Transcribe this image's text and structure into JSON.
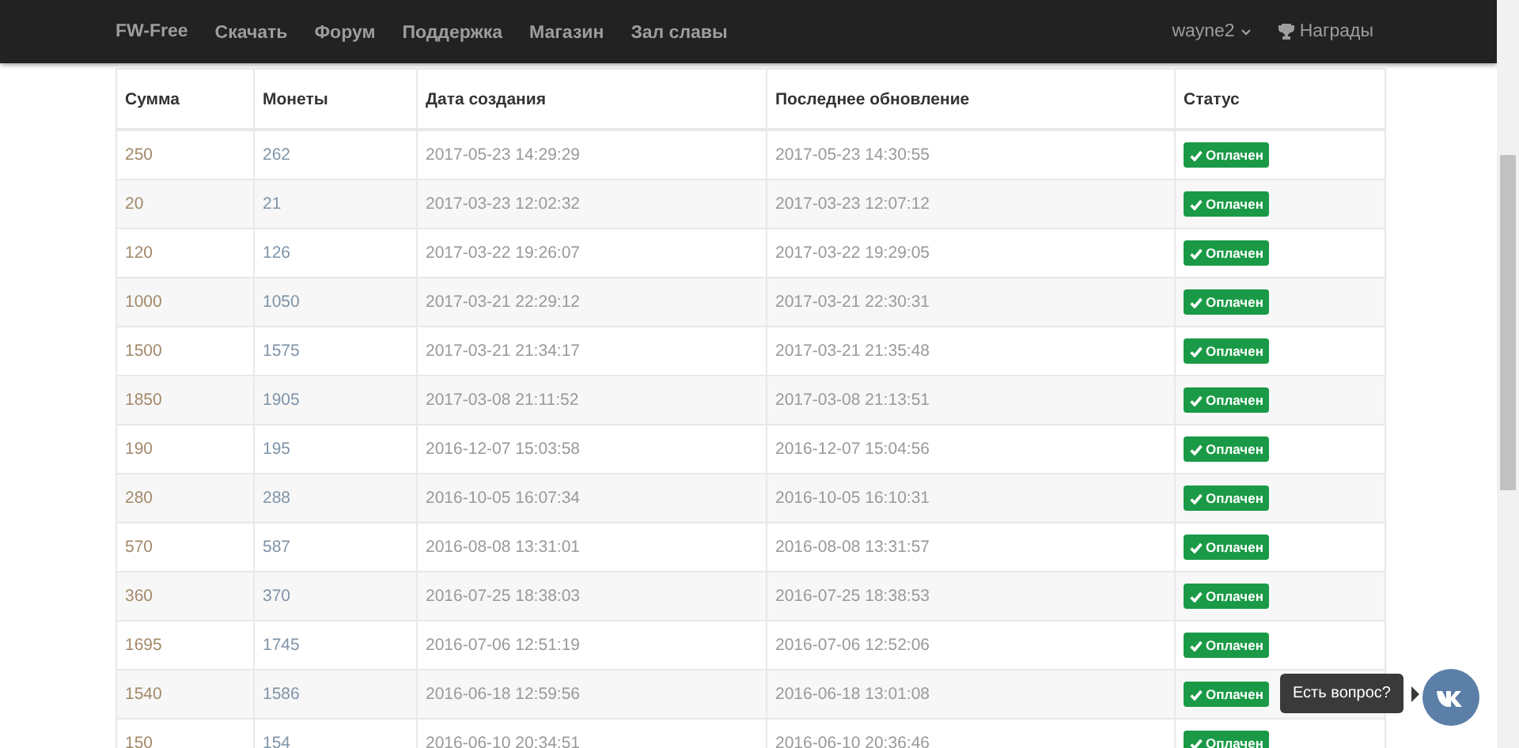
{
  "navbar": {
    "brand": "FW-Free",
    "links": [
      "Скачать",
      "Форум",
      "Поддержка",
      "Магазин",
      "Зал славы"
    ],
    "user": "wayne2",
    "awards": "Награды"
  },
  "table": {
    "columns": [
      "Сумма",
      "Монеты",
      "Дата создания",
      "Последнее обновление",
      "Статус"
    ],
    "rows": [
      {
        "sum": "250",
        "coins": "262",
        "created": "2017-05-23 14:29:29",
        "updated": "2017-05-23 14:30:55",
        "status": "Оплачен"
      },
      {
        "sum": "20",
        "coins": "21",
        "created": "2017-03-23 12:02:32",
        "updated": "2017-03-23 12:07:12",
        "status": "Оплачен"
      },
      {
        "sum": "120",
        "coins": "126",
        "created": "2017-03-22 19:26:07",
        "updated": "2017-03-22 19:29:05",
        "status": "Оплачен"
      },
      {
        "sum": "1000",
        "coins": "1050",
        "created": "2017-03-21 22:29:12",
        "updated": "2017-03-21 22:30:31",
        "status": "Оплачен"
      },
      {
        "sum": "1500",
        "coins": "1575",
        "created": "2017-03-21 21:34:17",
        "updated": "2017-03-21 21:35:48",
        "status": "Оплачен"
      },
      {
        "sum": "1850",
        "coins": "1905",
        "created": "2017-03-08 21:11:52",
        "updated": "2017-03-08 21:13:51",
        "status": "Оплачен"
      },
      {
        "sum": "190",
        "coins": "195",
        "created": "2016-12-07 15:03:58",
        "updated": "2016-12-07 15:04:56",
        "status": "Оплачен"
      },
      {
        "sum": "280",
        "coins": "288",
        "created": "2016-10-05 16:07:34",
        "updated": "2016-10-05 16:10:31",
        "status": "Оплачен"
      },
      {
        "sum": "570",
        "coins": "587",
        "created": "2016-08-08 13:31:01",
        "updated": "2016-08-08 13:31:57",
        "status": "Оплачен"
      },
      {
        "sum": "360",
        "coins": "370",
        "created": "2016-07-25 18:38:03",
        "updated": "2016-07-25 18:38:53",
        "status": "Оплачен"
      },
      {
        "sum": "1695",
        "coins": "1745",
        "created": "2016-07-06 12:51:19",
        "updated": "2016-07-06 12:52:06",
        "status": "Оплачен"
      },
      {
        "sum": "1540",
        "coins": "1586",
        "created": "2016-06-18 12:59:56",
        "updated": "2016-06-18 13:01:08",
        "status": "Оплачен"
      },
      {
        "sum": "150",
        "coins": "154",
        "created": "2016-06-10 20:34:51",
        "updated": "2016-06-10 20:36:46",
        "status": "Оплачен"
      }
    ]
  },
  "chat_widget": {
    "tooltip": "Есть вопрос?"
  }
}
